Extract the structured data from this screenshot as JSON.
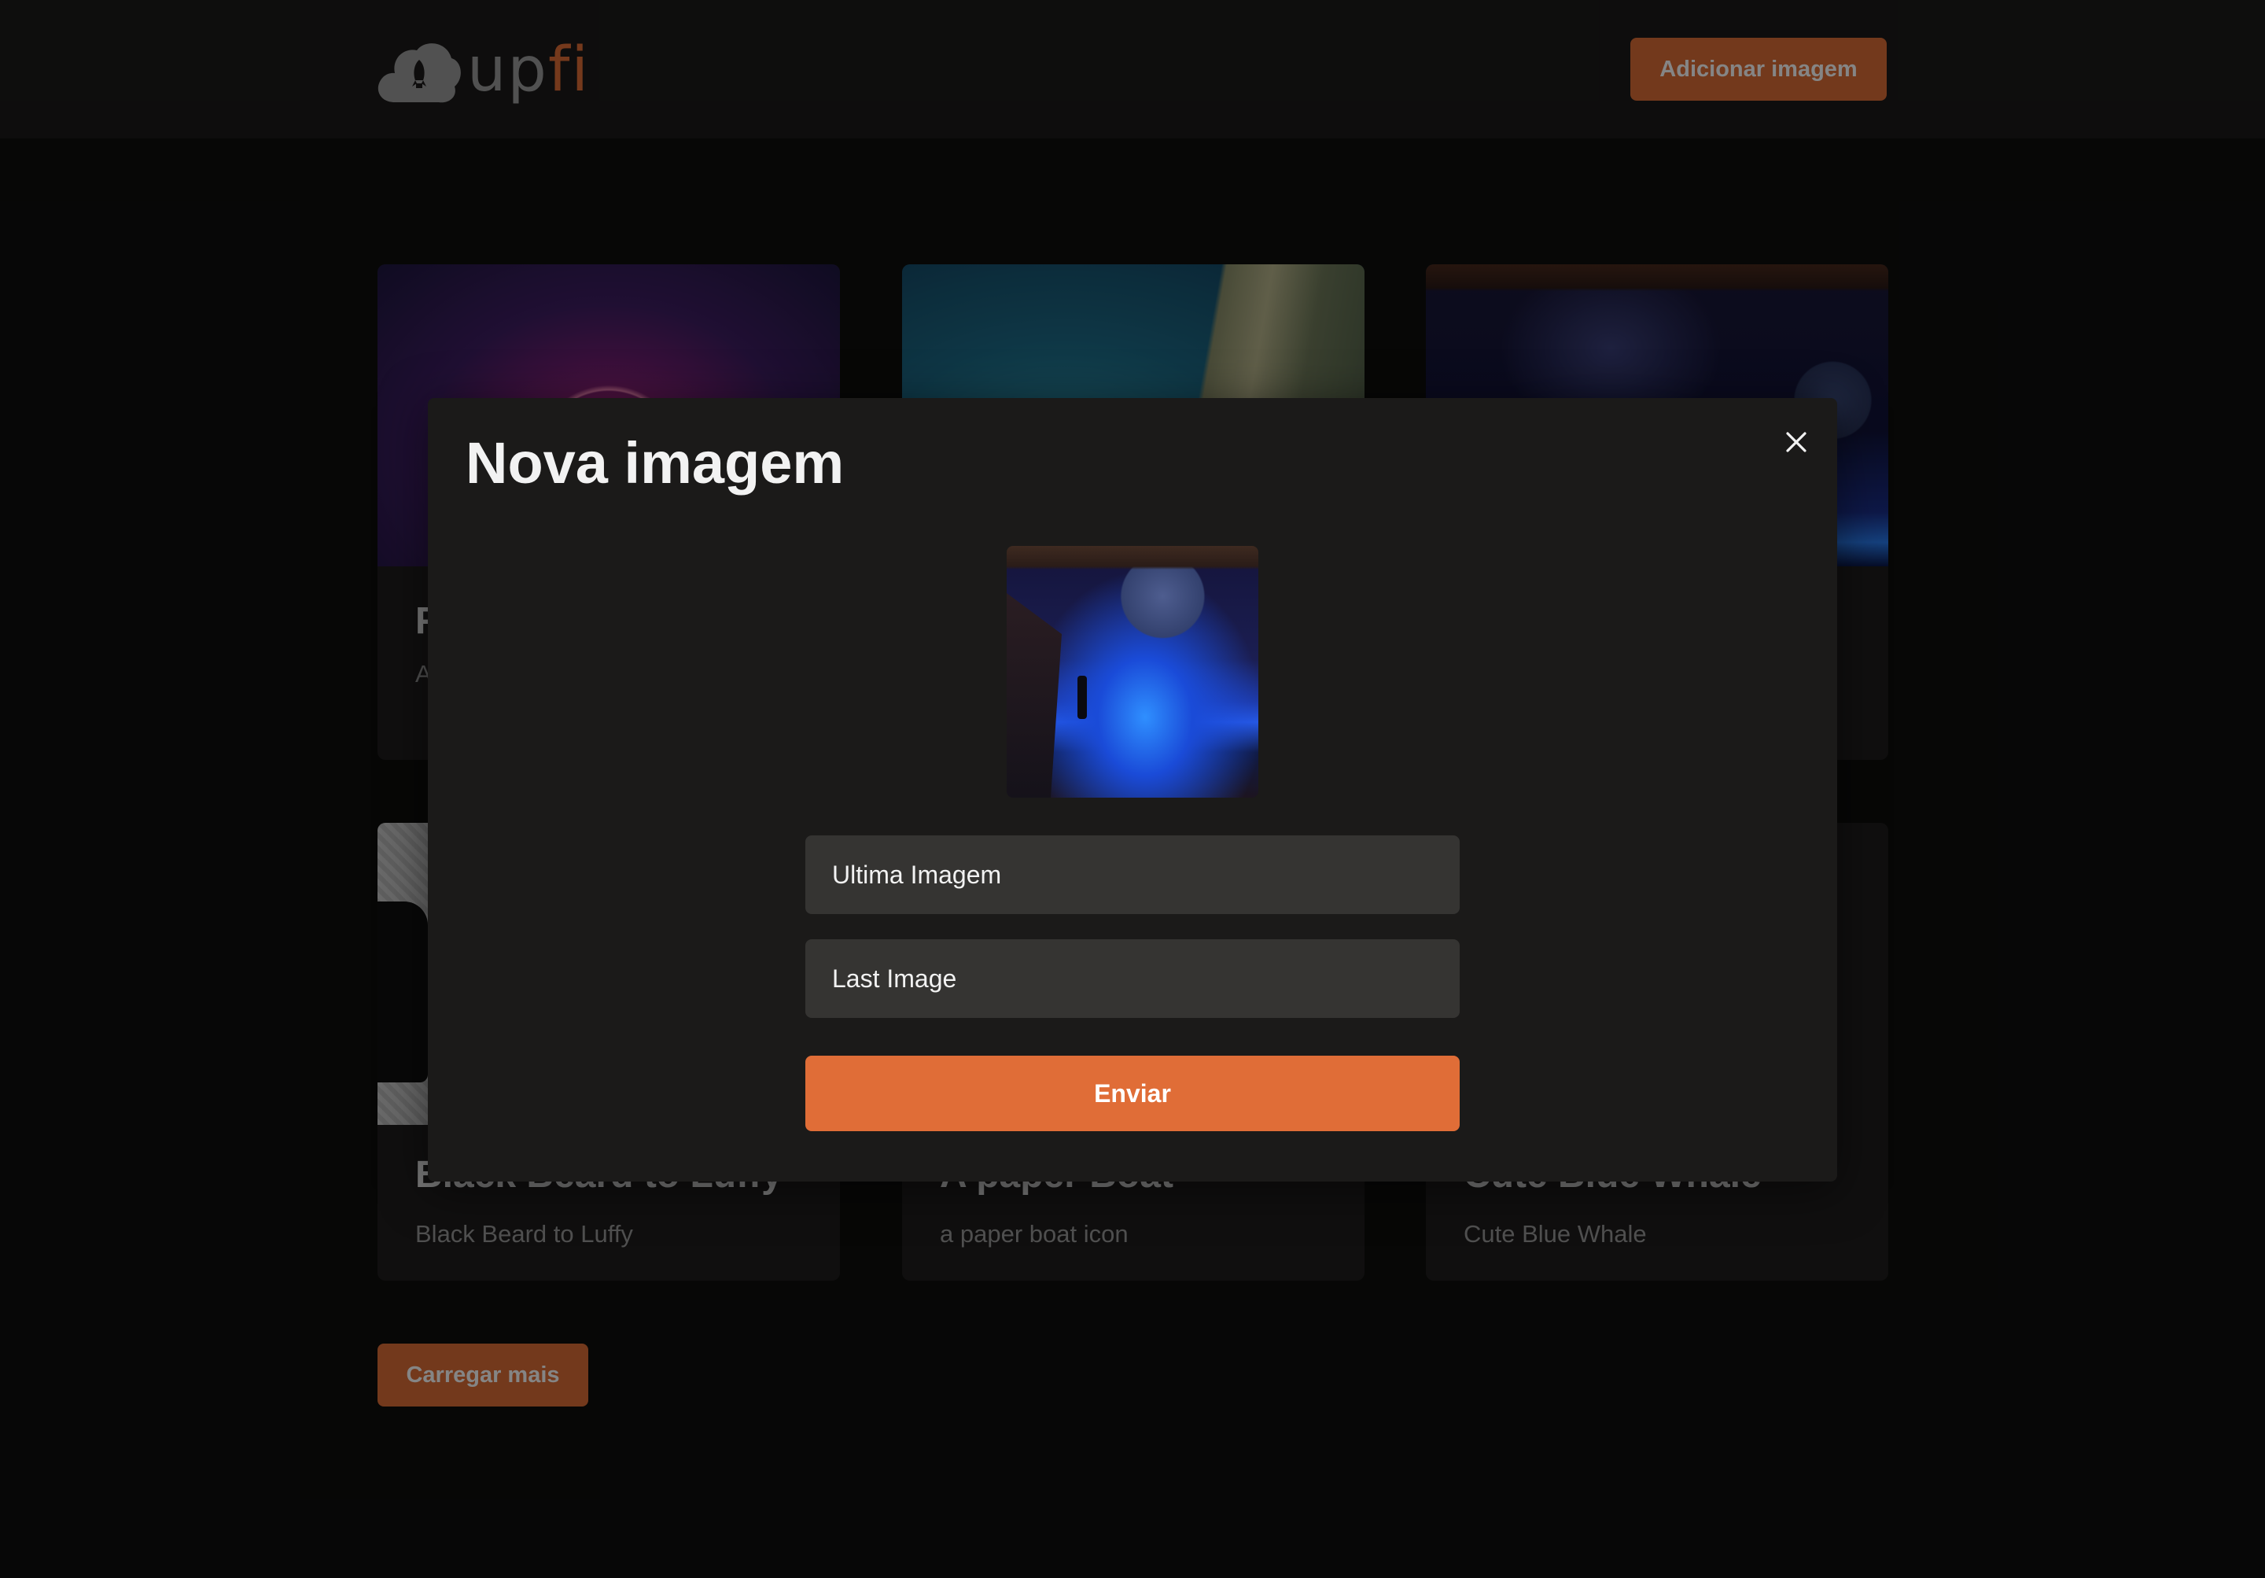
{
  "header": {
    "logo_primary": "up",
    "logo_accent": "fi",
    "add_image_label": "Adicionar imagem"
  },
  "cards": [
    {
      "title": "F",
      "description": "A p",
      "image": "neon-ring-cityscape"
    },
    {
      "title": "",
      "description": "",
      "image": "ocean-floating-city"
    },
    {
      "title": "",
      "description": "",
      "image": "night-harbor-planets"
    },
    {
      "title": "Black Beard to Luffy",
      "description": "Black Beard to Luffy",
      "image": "manga-panel"
    },
    {
      "title": "A paper Boat",
      "description": "a paper boat icon",
      "image": ""
    },
    {
      "title": "Cute Blue Whale",
      "description": "Cute Blue Whale",
      "image": ""
    }
  ],
  "load_more_label": "Carregar mais",
  "modal": {
    "title": "Nova imagem",
    "close_icon": "close-icon",
    "preview_image": "night-harbor-planets",
    "title_field_value": "Ultima Imagem",
    "description_field_value": "Last Image",
    "submit_label": "Enviar"
  },
  "colors": {
    "accent": "#e06d37",
    "background": "#0e0e0d",
    "surface": "#1b1a19",
    "input": "#353432"
  }
}
